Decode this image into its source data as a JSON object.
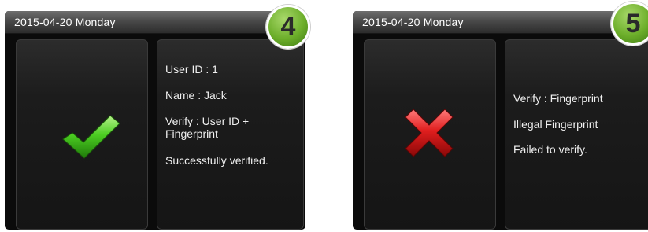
{
  "screens": [
    {
      "status_bar": {
        "date": "2015-04-20",
        "weekday": "Monday",
        "date_text": "2015-04-20  Monday"
      },
      "result_icon": "check-icon",
      "info_lines": [
        "User ID : 1",
        "Name : Jack",
        "Verify : User ID +\nFingerprint",
        "Successfully verified."
      ],
      "badge": "4"
    },
    {
      "status_bar": {
        "date": "2015-04-20",
        "weekday": "Monday",
        "date_text": "2015-04-20  Monday"
      },
      "result_icon": "cross-icon",
      "info_lines": [
        "Verify : Fingerprint",
        "Illegal Fingerprint",
        "Failed to verify."
      ],
      "badge": "5"
    }
  ],
  "colors": {
    "success": "#3fbf1f",
    "failure": "#d81a1a",
    "badge": "#6cae2a"
  }
}
